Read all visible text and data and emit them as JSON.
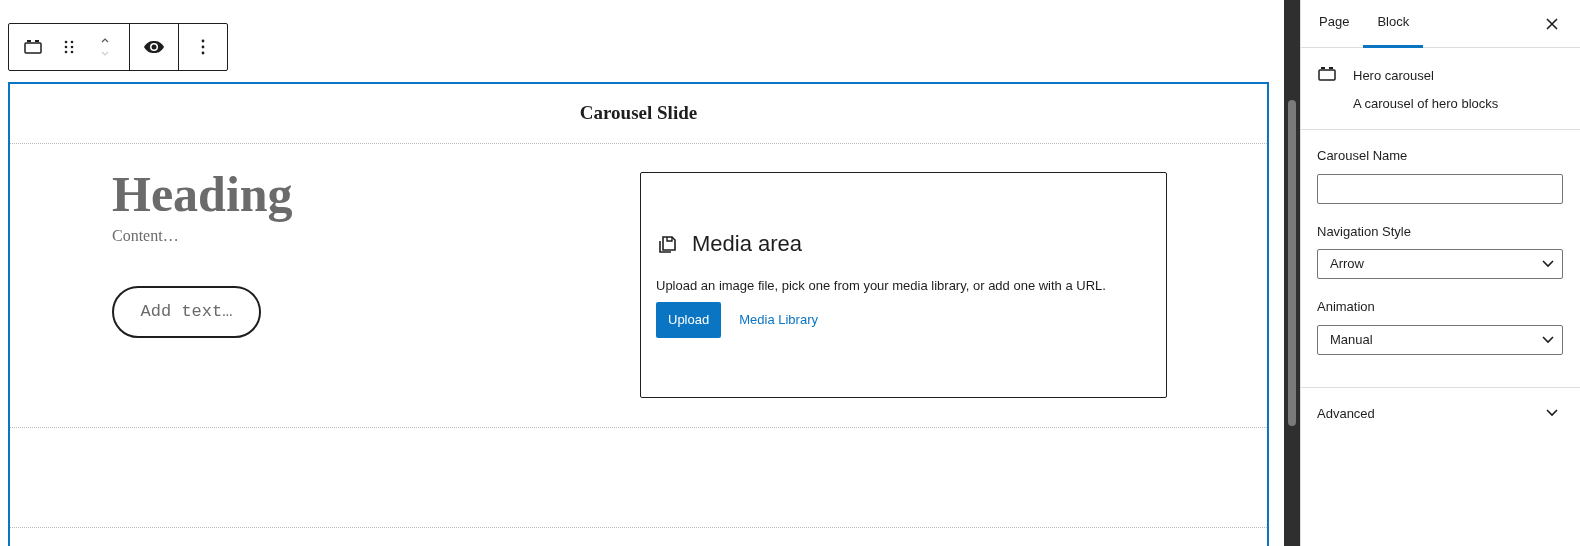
{
  "block_title": "Carousel Slide",
  "slide": {
    "heading": "Heading",
    "content": "Content…",
    "button_placeholder": "Add text…"
  },
  "media": {
    "title": "Media area",
    "instructions": "Upload an image file, pick one from your media library, or add one with a URL.",
    "upload_button": "Upload",
    "library_link": "Media Library"
  },
  "sidebar": {
    "tabs": [
      {
        "label": "Page",
        "selected": false
      },
      {
        "label": "Block",
        "selected": true
      }
    ],
    "block_card": {
      "name": "Hero carousel",
      "description": "A carousel of hero blocks"
    },
    "fields": [
      {
        "kind": "text",
        "label": "Carousel Name"
      },
      {
        "kind": "select",
        "label": "Navigation Style",
        "value": "Arrow"
      },
      {
        "kind": "select",
        "label": "Animation",
        "value": "Manual"
      }
    ],
    "panels": [
      {
        "title": "Advanced",
        "expanded": false
      }
    ]
  }
}
